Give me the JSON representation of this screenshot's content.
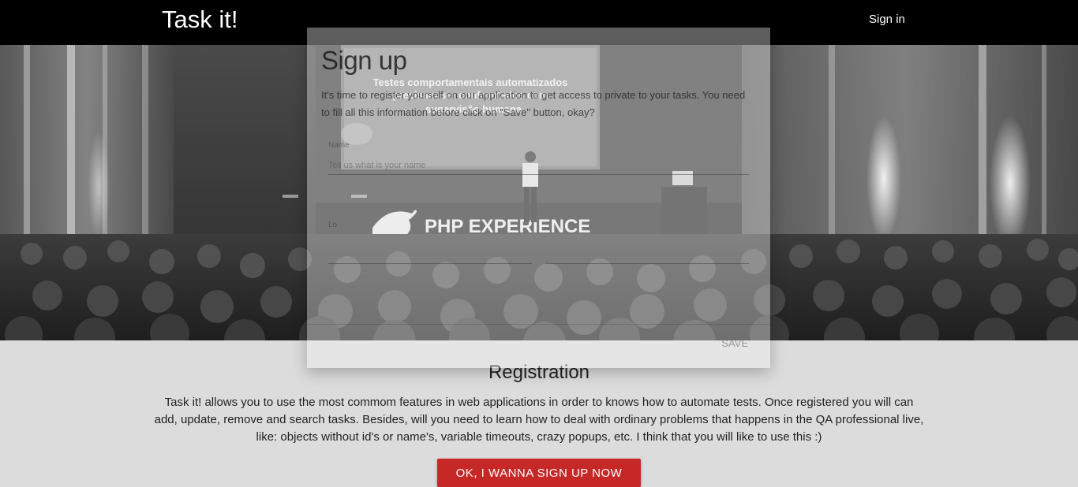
{
  "nav": {
    "brand": "Task it!",
    "signin_label": "Sign in"
  },
  "hero": {
    "slide_line1": "Testes comportamentais automatizados",
    "slide_line2": "precisam ser confrontados com",
    "slide_line3": "supervisão humana",
    "banner_text": "PHP EXPERIENCE"
  },
  "modal": {
    "title": "Sign up",
    "description": "It's time to register yourself on our application to get access to private to your tasks. You need to fill all this information before click on \"Save\" button, okay?",
    "name_label": "Name",
    "name_placeholder": "Tell us what is your name",
    "login_label": "Lo",
    "save_label": "Save"
  },
  "registration": {
    "title": "Registration",
    "text": "Task it! allows you to use the most commom features in web applications in order to knows how to automate tests. Once registered you will can add, update, remove and search tasks. Besides, will you need to learn how to deal with ordinary problems that happens in the QA professional live, like: objects without id's or name's, variable timeouts, crazy popups, etc. I think that you will like to use this :)",
    "cta_label": "OK, I wanna sign up now"
  },
  "colors": {
    "nav_bg": "#000000",
    "cta": "#c62828",
    "page_bg": "#dcdcdc"
  }
}
